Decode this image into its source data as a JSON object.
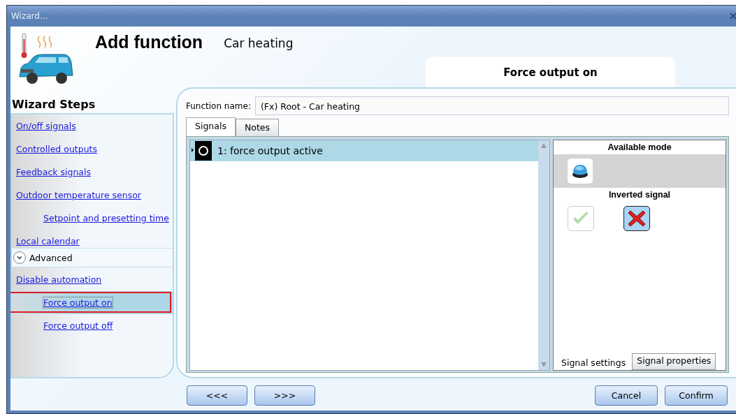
{
  "window": {
    "title": "Wizard..."
  },
  "header": {
    "title": "Add function",
    "subtitle": "Car heating",
    "step_title": "Force output on"
  },
  "steps": {
    "title": "Wizard Steps",
    "items": [
      {
        "label": "On/off signals",
        "selected": false
      },
      {
        "label": "Controlled outputs",
        "selected": false
      },
      {
        "label": "Feedback signals",
        "selected": false
      },
      {
        "label": "Outdoor temperature sensor",
        "selected": false,
        "children": [
          {
            "label": "Setpoint and presetting time",
            "selected": false
          }
        ]
      },
      {
        "label": "Local calendar",
        "selected": false
      }
    ],
    "advanced": {
      "label": "Advanced",
      "expanded": true,
      "items": [
        {
          "label": "Disable automation",
          "selected": false,
          "children": [
            {
              "label": "Force output on",
              "selected": true,
              "annotated": true
            },
            {
              "label": "Force output off",
              "selected": false
            }
          ]
        }
      ]
    }
  },
  "function_name": {
    "label": "Function name:",
    "value": "(Fx) Root - Car heating"
  },
  "tabs": [
    {
      "label": "Signals",
      "selected": true
    },
    {
      "label": "Notes",
      "selected": false
    }
  ],
  "signals": [
    {
      "label": "1: force output active",
      "selected": true
    }
  ],
  "side_panel": {
    "available_mode_title": "Available mode",
    "inverted_title": "Inverted signal",
    "inverted_options": [
      {
        "kind": "check",
        "selected": false
      },
      {
        "kind": "cross",
        "selected": true
      }
    ],
    "tabs": [
      {
        "label": "Signal settings",
        "selected": true
      },
      {
        "label": "Signal properties",
        "selected": false
      }
    ]
  },
  "buttons": [
    {
      "label": "<<<",
      "kind": "nav"
    },
    {
      "label": ">>>",
      "kind": "nav"
    },
    {
      "label": "Cancel",
      "kind": "action"
    },
    {
      "label": "Confirm",
      "kind": "action"
    }
  ]
}
